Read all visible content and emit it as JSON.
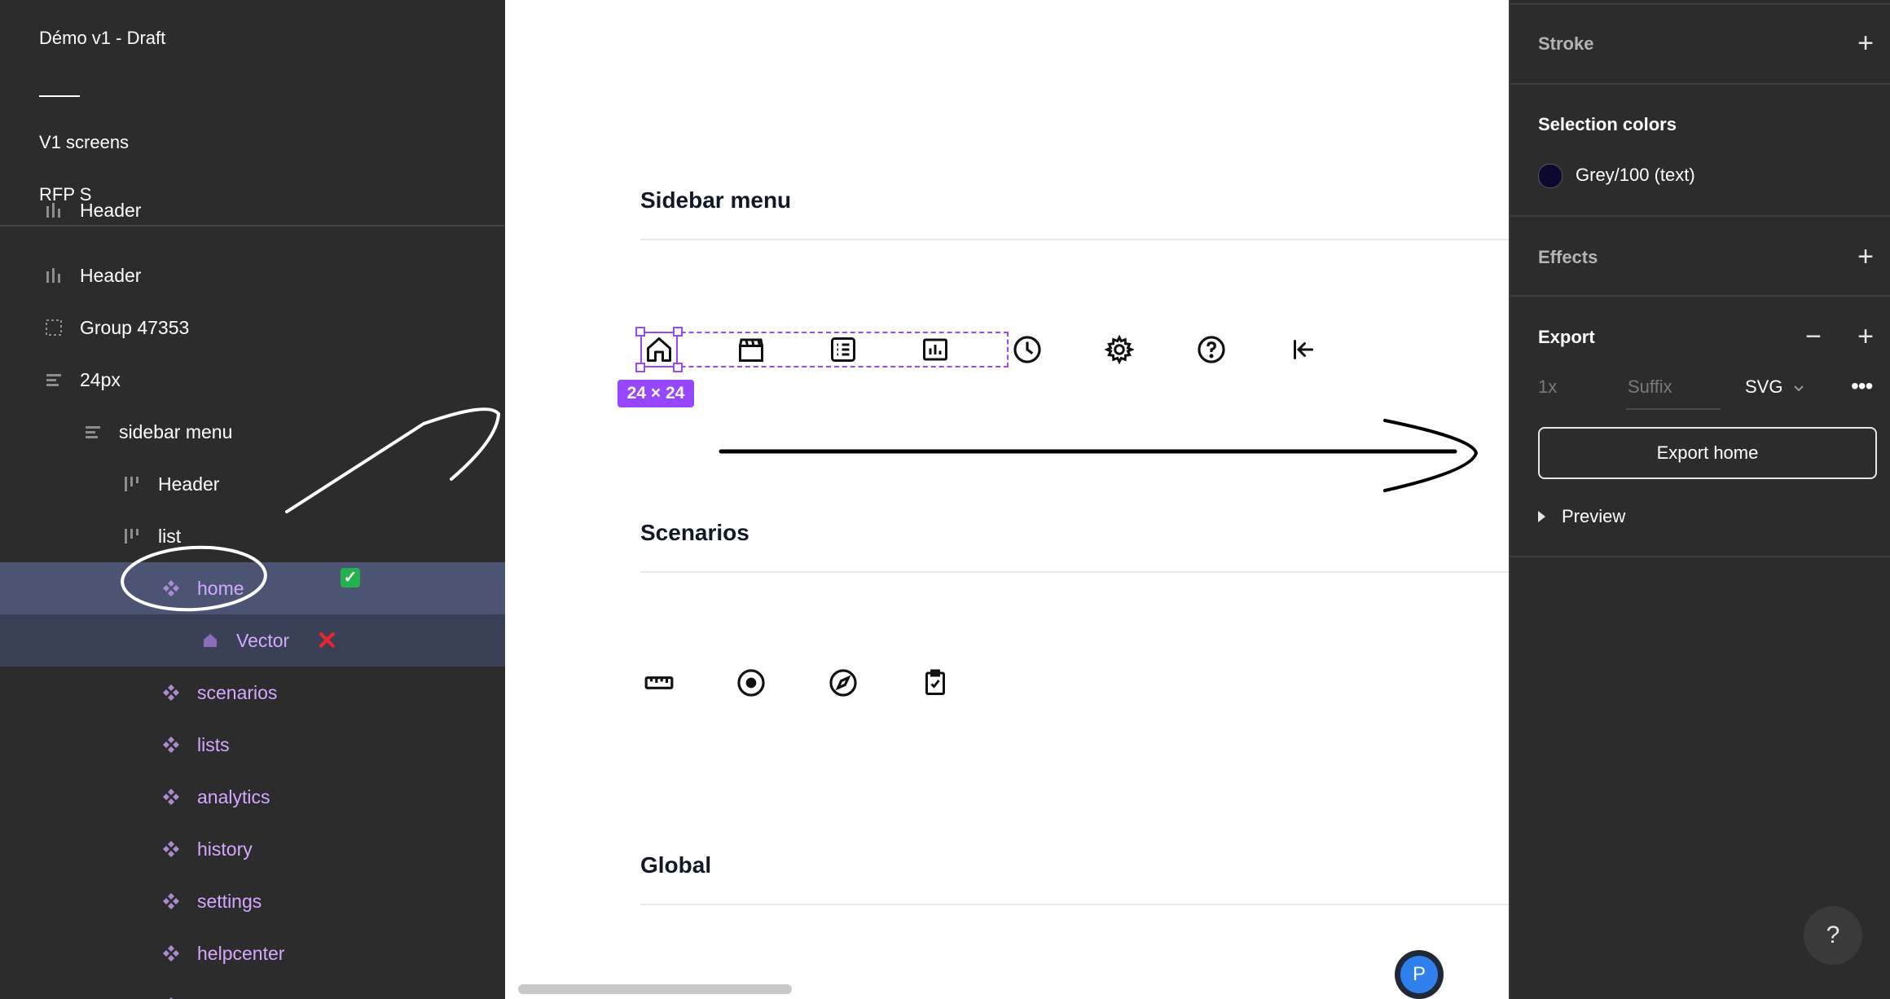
{
  "pages_panel": {
    "file_title": "Démo v1 - Draft",
    "pages": [
      "V1 screens",
      "RFP S"
    ]
  },
  "layers": {
    "partial_top": "Header",
    "items": [
      {
        "label": "Header",
        "icon": "bars-icon"
      },
      {
        "label": "Group 47353",
        "icon": "group-icon"
      },
      {
        "label": "24px",
        "icon": "autolayout-icon"
      },
      {
        "label": "sidebar menu",
        "icon": "autolayout-icon"
      },
      {
        "label": "Header",
        "icon": "columns-icon"
      },
      {
        "label": "list",
        "icon": "columns-icon"
      },
      {
        "label": "home",
        "icon": "component-icon"
      },
      {
        "label": "Vector",
        "icon": "home-vector-icon"
      },
      {
        "label": "scenarios",
        "icon": "component-icon"
      },
      {
        "label": "lists",
        "icon": "component-icon"
      },
      {
        "label": "analytics",
        "icon": "component-icon"
      },
      {
        "label": "history",
        "icon": "component-icon"
      },
      {
        "label": "settings",
        "icon": "component-icon"
      },
      {
        "label": "helpcenter",
        "icon": "component-icon"
      }
    ],
    "ok_mark": "✓",
    "x_mark": "✕"
  },
  "canvas": {
    "sections": [
      "Sidebar menu",
      "Scenarios",
      "Global"
    ],
    "sidebar_icons": [
      "home-icon",
      "clapperboard-icon",
      "list-icon",
      "analytics-icon",
      "clock-icon",
      "gear-icon",
      "help-circle-icon",
      "collapse-left-icon"
    ],
    "scenario_icons": [
      "ruler-icon",
      "target-icon",
      "compass-icon",
      "clipboard-check-icon"
    ],
    "dimension_badge": "24 × 24",
    "avatar_initial": "P",
    "selection_color": "#9747ff"
  },
  "properties": {
    "stroke_title": "Stroke",
    "selection_colors_title": "Selection colors",
    "color_label": "Grey/100 (text)",
    "color_hex": "#0b0a2e",
    "effects_title": "Effects",
    "export_title": "Export",
    "export_scale": "1x",
    "export_suffix_placeholder": "Suffix",
    "export_format": "SVG",
    "export_button": "Export home",
    "preview_label": "Preview",
    "help_label": "?"
  }
}
